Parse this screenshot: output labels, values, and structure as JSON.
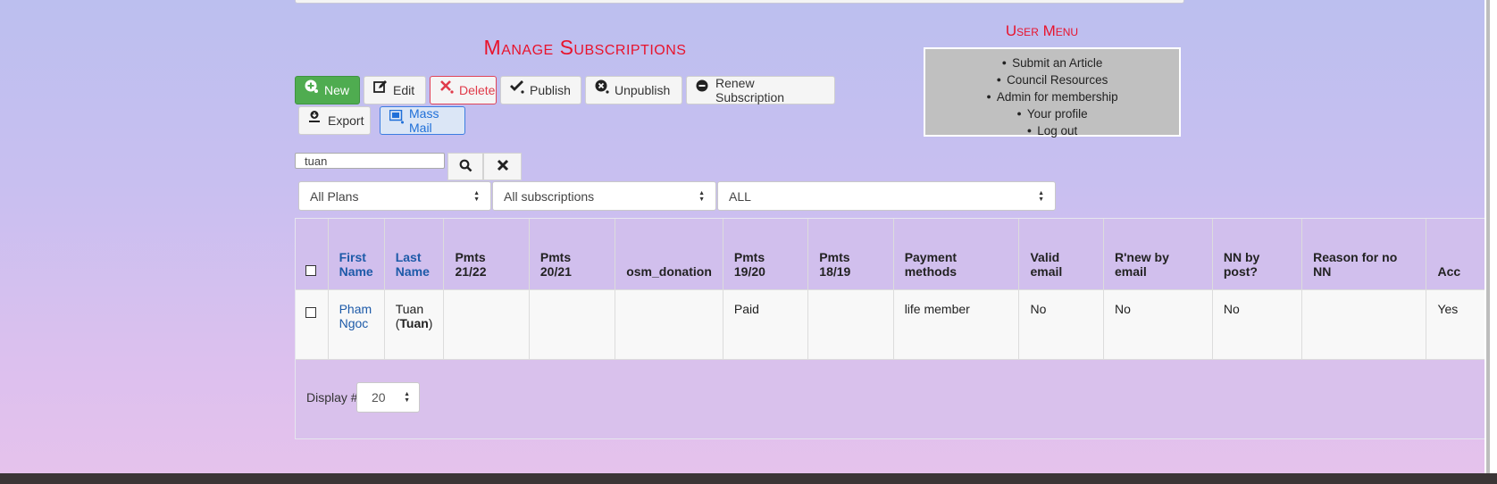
{
  "page": {
    "title": "Manage Subscriptions"
  },
  "user_menu": {
    "title": "User Menu",
    "items": [
      "Submit an Article",
      "Council Resources",
      "Admin for membership",
      "Your profile",
      "Log out"
    ]
  },
  "toolbar": {
    "new": "New",
    "edit": "Edit",
    "delete": "Delete",
    "publish": "Publish",
    "unpublish": "Unpublish",
    "renew": "Renew Subscription",
    "export": "Export",
    "mass_mail": "Mass Mail"
  },
  "search": {
    "value": "tuan"
  },
  "filters": {
    "plans": "All Plans",
    "subscriptions": "All subscriptions",
    "all": "ALL"
  },
  "table": {
    "headers": {
      "first_name_1": "First",
      "first_name_2": "Name",
      "last_name_1": "Last",
      "last_name_2": "Name",
      "pmts_2122": "Pmts 21/22",
      "pmts_2021": "Pmts 20/21",
      "osm_donation": "osm_donation",
      "pmts_1920": "Pmts 19/20",
      "pmts_1819": "Pmts 18/19",
      "payment_methods": "Payment methods",
      "valid_email": "Valid email",
      "renew_by_email": "R'new by email",
      "nn_by_post": "NN by post?",
      "reason_no_nn": "Reason for no NN",
      "acc": "Acc"
    },
    "row": {
      "first_1": "Pham",
      "first_2": "Ngoc",
      "last_1": "Tuan",
      "last_2_open": "(",
      "last_2_bold": "Tuan",
      "last_2_close": ")",
      "pmts_2122": "",
      "pmts_2021": "",
      "osm_donation": "",
      "pmts_1920": "Paid",
      "pmts_1819": "",
      "payment_methods": "life member",
      "valid_email": "No",
      "renew_by_email": "No",
      "nn_by_post": "No",
      "reason_no_nn": "",
      "acc": "Yes"
    }
  },
  "pagination": {
    "label": "Display #",
    "value": "20"
  },
  "colors": {
    "accent_red": "#e8132c",
    "link_blue": "#1d5aa8",
    "new_green": "#4fac50"
  }
}
